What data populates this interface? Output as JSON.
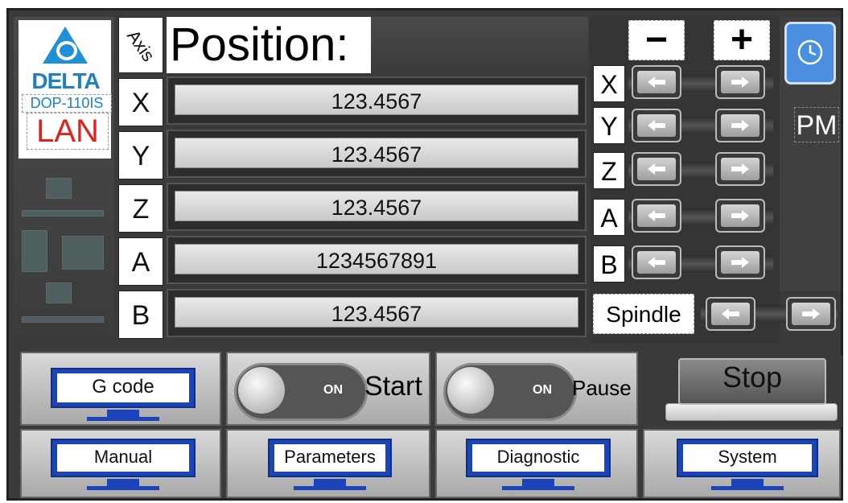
{
  "logo": {
    "brand": "DELTA",
    "model": "DOP-110IS",
    "connection": "LAN"
  },
  "axis_header": "Axis",
  "position_title": "Position:",
  "axes": [
    {
      "label": "X",
      "value": "123.4567"
    },
    {
      "label": "Y",
      "value": "123.4567"
    },
    {
      "label": "Z",
      "value": "123.4567"
    },
    {
      "label": "A",
      "value": "1234567891"
    },
    {
      "label": "B",
      "value": "123.4567"
    }
  ],
  "jog": {
    "minus": "−",
    "plus": "+",
    "rows": [
      "X",
      "Y",
      "Z",
      "A",
      "B"
    ],
    "spindle": "Spindle"
  },
  "right": {
    "pm_label": "PM",
    "clock_icon": "clock-icon"
  },
  "bottom": {
    "gcode": "G code",
    "start": "Start",
    "start_toggle": "ON",
    "pause": "Pause",
    "pause_toggle": "ON",
    "stop": "Stop",
    "manual": "Manual",
    "parameters": "Parameters",
    "diagnostic": "Diagnostic",
    "system": "System"
  },
  "colors": {
    "accent_blue": "#1f8fd8",
    "lan_red": "#e3221c",
    "monitor_blue": "#1b44b8",
    "clock_blue": "#4a8fe0"
  }
}
